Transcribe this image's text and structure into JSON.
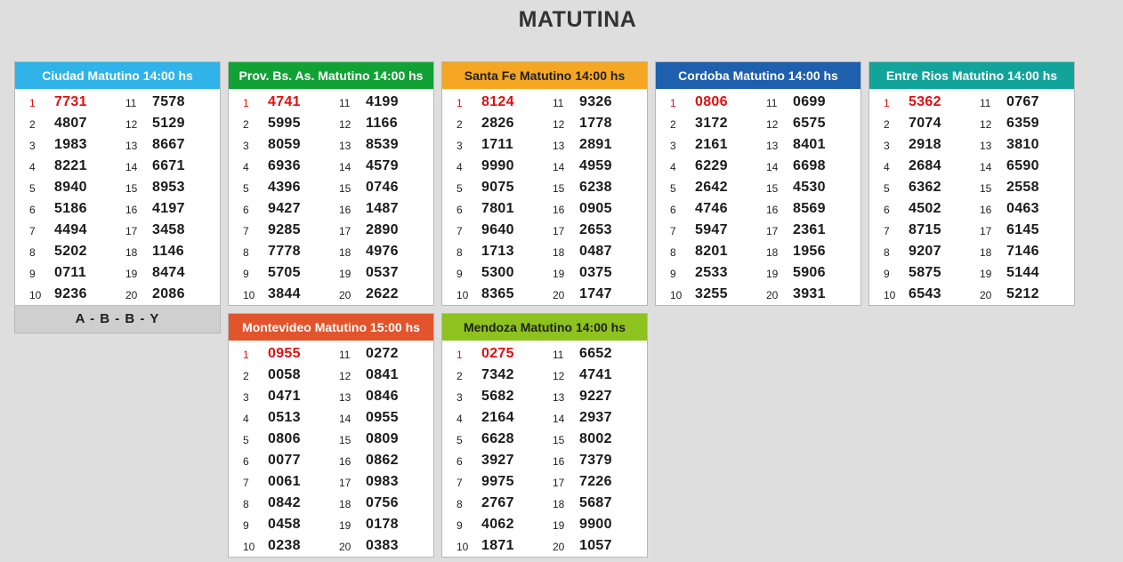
{
  "page": {
    "title": "MATUTINA"
  },
  "panels": [
    {
      "title": "Ciudad Matutino 14:00 hs",
      "color": "#2fb3e8",
      "footer": "A - B - B - Y",
      "numbers": [
        "7731",
        "4807",
        "1983",
        "8221",
        "8940",
        "5186",
        "4494",
        "5202",
        "0711",
        "9236",
        "7578",
        "5129",
        "8667",
        "6671",
        "8953",
        "4197",
        "3458",
        "1146",
        "8474",
        "2086"
      ]
    },
    {
      "title": "Prov. Bs. As. Matutino 14:00 hs",
      "color": "#12a135",
      "numbers": [
        "4741",
        "5995",
        "8059",
        "6936",
        "4396",
        "9427",
        "9285",
        "7778",
        "5705",
        "3844",
        "4199",
        "1166",
        "8539",
        "4579",
        "0746",
        "1487",
        "2890",
        "4976",
        "0537",
        "2622"
      ]
    },
    {
      "title": "Santa Fe Matutino 14:00 hs",
      "color": "#f5a623",
      "numbers": [
        "8124",
        "2826",
        "1711",
        "9990",
        "9075",
        "7801",
        "9640",
        "1713",
        "5300",
        "8365",
        "9326",
        "1778",
        "2891",
        "4959",
        "6238",
        "0905",
        "2653",
        "0487",
        "0375",
        "1747"
      ]
    },
    {
      "title": "Cordoba Matutino 14:00 hs",
      "color": "#1e5fae",
      "numbers": [
        "0806",
        "3172",
        "2161",
        "6229",
        "2642",
        "4746",
        "5947",
        "8201",
        "2533",
        "3255",
        "0699",
        "6575",
        "8401",
        "6698",
        "4530",
        "8569",
        "2361",
        "1956",
        "5906",
        "3931"
      ]
    },
    {
      "title": "Entre Rios Matutino 14:00 hs",
      "color": "#12a39a",
      "numbers": [
        "5362",
        "7074",
        "2918",
        "2684",
        "6362",
        "4502",
        "8715",
        "9207",
        "5875",
        "6543",
        "0767",
        "6359",
        "3810",
        "6590",
        "2558",
        "0463",
        "6145",
        "7146",
        "5144",
        "5212"
      ]
    },
    {
      "title": "Montevideo Matutino 15:00 hs",
      "color": "#e2542c",
      "numbers": [
        "0955",
        "0058",
        "0471",
        "0513",
        "0806",
        "0077",
        "0061",
        "0842",
        "0458",
        "0238",
        "0272",
        "0841",
        "0846",
        "0955",
        "0809",
        "0862",
        "0983",
        "0756",
        "0178",
        "0383"
      ]
    },
    {
      "title": "Mendoza Matutino 14:00 hs",
      "color": "#8dc21f",
      "numbers": [
        "0275",
        "7342",
        "5682",
        "2164",
        "6628",
        "3927",
        "9975",
        "2767",
        "4062",
        "1871",
        "6652",
        "4741",
        "9227",
        "2937",
        "8002",
        "7379",
        "7226",
        "5687",
        "9900",
        "1057"
      ]
    }
  ]
}
